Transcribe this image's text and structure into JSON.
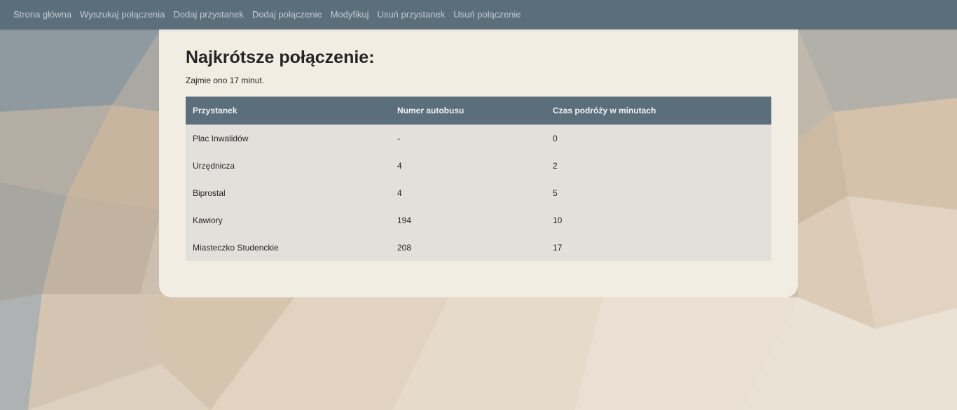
{
  "nav": {
    "items": [
      "Strona główna",
      "Wyszukaj połączenia",
      "Dodaj przystanek",
      "Dodaj połączenie",
      "Modyfikuj",
      "Usuń przystanek",
      "Usuń połączenie"
    ]
  },
  "result": {
    "title": "Najkrótsze połączenie:",
    "summary": "Zajmie ono 17 minut."
  },
  "table": {
    "headers": [
      "Przystanek",
      "Numer autobusu",
      "Czas podróży w minutach"
    ],
    "rows": [
      [
        "Plac Inwalidów",
        "-",
        "0"
      ],
      [
        "Urzędnicza",
        "4",
        "2"
      ],
      [
        "Biprostal",
        "4",
        "5"
      ],
      [
        "Kawiory",
        "194",
        "10"
      ],
      [
        "Miasteczko Studenckie",
        "208",
        "17"
      ]
    ]
  },
  "colors": {
    "navbar": "#5b6e7b",
    "card": "#f2ede3",
    "table_header": "#5b6e7b",
    "table_row": "#e3e0dc"
  }
}
